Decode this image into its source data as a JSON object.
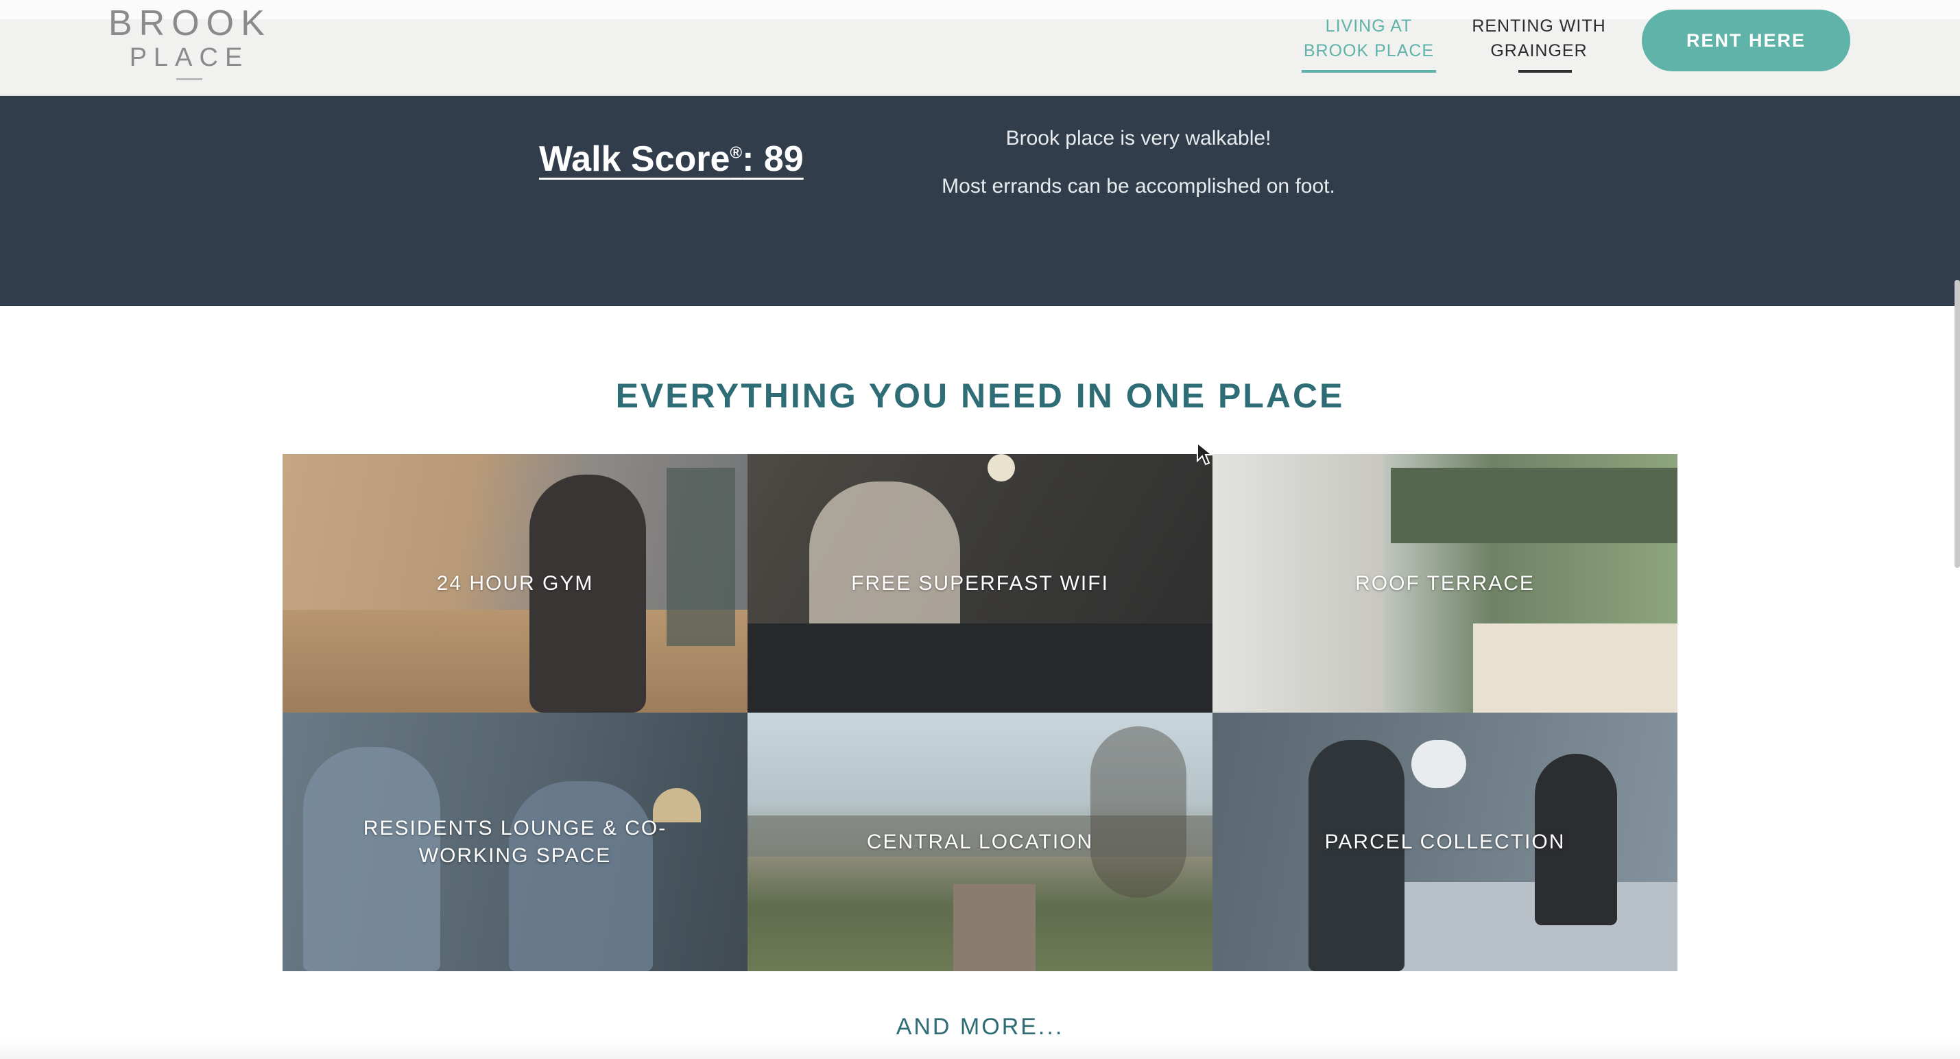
{
  "header": {
    "logo_line1": "BROOK",
    "logo_line2": "PLACE",
    "nav_living": "LIVING AT BROOK PLACE",
    "nav_renting": "RENTING WITH GRAINGER",
    "cta_label": "RENT HERE"
  },
  "walk_score": {
    "title": "Walk Score",
    "registered_mark": "®",
    "value_text": ": 89",
    "line1": "Brook place is very walkable!",
    "line2": "Most errands can be accomplished on foot."
  },
  "amenities": {
    "heading": "EVERYTHING YOU NEED IN ONE PLACE",
    "tiles": [
      {
        "label": "24 HOUR GYM"
      },
      {
        "label": "FREE SUPERFAST WIFI"
      },
      {
        "label": "ROOF TERRACE"
      },
      {
        "label": "RESIDENTS LOUNGE & CO-WORKING SPACE"
      },
      {
        "label": "CENTRAL LOCATION"
      },
      {
        "label": "PARCEL COLLECTION"
      }
    ],
    "more_label": "AND MORE..."
  },
  "colors": {
    "accent": "#5fb3a8",
    "dark_band": "#313d4b",
    "heading": "#2f6d76"
  }
}
